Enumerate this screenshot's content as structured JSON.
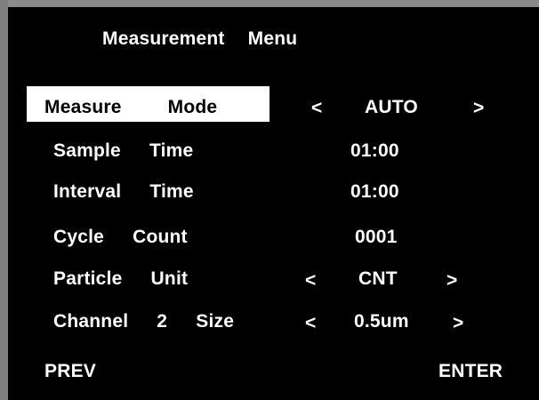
{
  "menu": {
    "title": "Measurement  Menu",
    "rows": [
      {
        "label": "Measure  Mode",
        "value": "AUTO",
        "prev_arrow": "<",
        "next_arrow": ">",
        "selected": true
      },
      {
        "label": "Sample  Time",
        "value": "01:00"
      },
      {
        "label": "Interval  Time",
        "value": "01:00"
      },
      {
        "label": "Cycle  Count",
        "value": "0001"
      },
      {
        "label": "Particle  Unit",
        "value": "CNT",
        "prev_arrow": "<",
        "next_arrow": ">"
      },
      {
        "label": "Channel  2  Size",
        "value": "0.5um",
        "prev_arrow": "<",
        "next_arrow": ">"
      }
    ]
  },
  "footer": {
    "prev_label": "PREV",
    "enter_label": "ENTER"
  },
  "colors": {
    "background": "#000000",
    "text": "#ffffff",
    "highlight_bg": "#ffffff",
    "highlight_text": "#000000",
    "frame": "#808080"
  }
}
